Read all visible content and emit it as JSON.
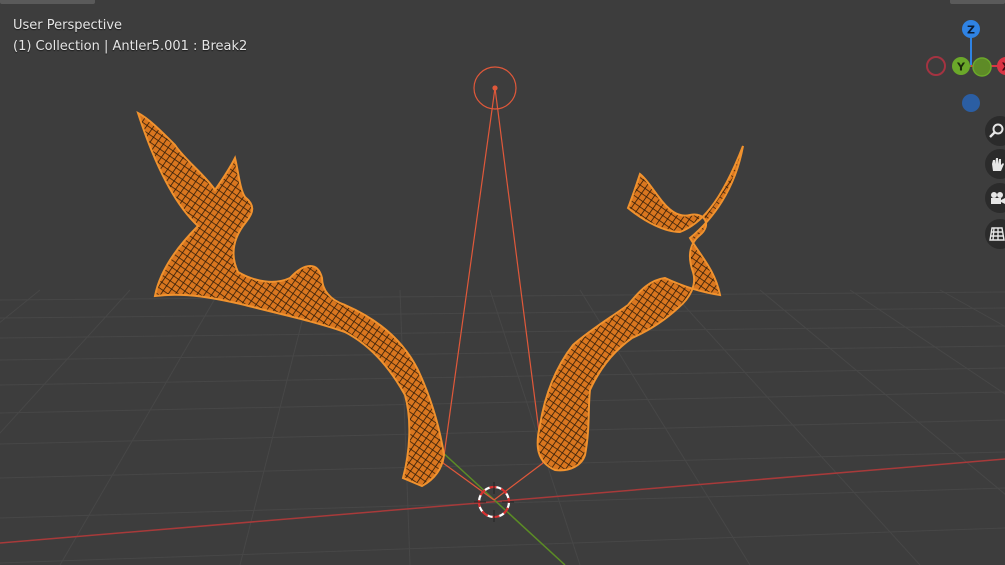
{
  "viewport": {
    "view_name": "User Perspective",
    "object_info": "(1) Collection | Antler5.001 : Break2"
  },
  "gizmo": {
    "axes": [
      {
        "label": "Z",
        "color": "#2f83e4"
      },
      {
        "label": "Y",
        "color": "#6ba82a"
      },
      {
        "label": "X",
        "color": "#d93444"
      }
    ],
    "negative_colors": {
      "x": "#a43341",
      "y": "#5e8b27",
      "z": "#2b5ea3"
    }
  },
  "navigation_tools": [
    {
      "name": "zoom-icon"
    },
    {
      "name": "hand-pan-icon"
    },
    {
      "name": "camera-icon"
    },
    {
      "name": "grid-ortho-icon"
    }
  ],
  "colors": {
    "background": "#3d3d3d",
    "grid": "#484848",
    "x_axis": "#a83a3a",
    "y_axis": "#5b8c25",
    "selection": "#f0922e",
    "light_line": "#e0583a",
    "text": "#e6e6e6"
  }
}
